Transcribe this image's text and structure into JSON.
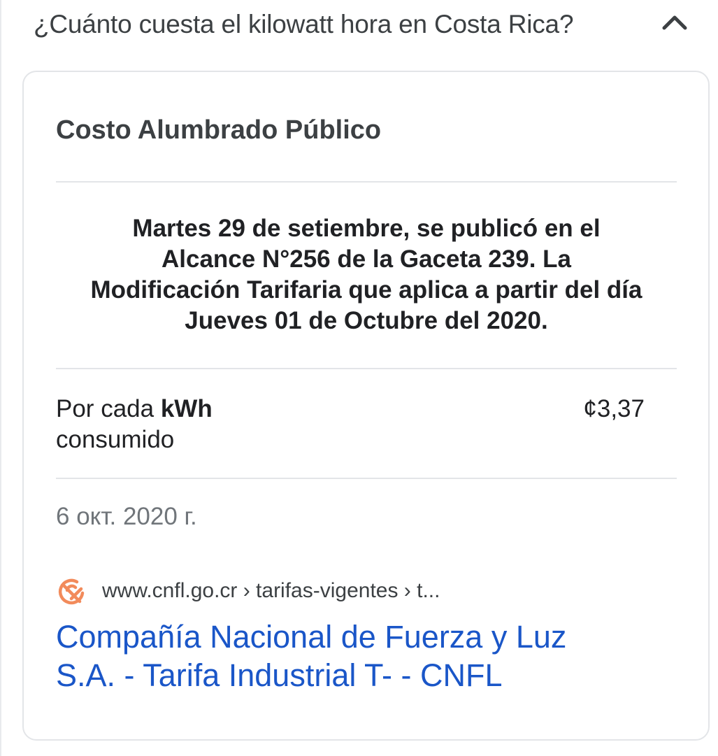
{
  "question": {
    "text": "¿Cuánto cuesta el kilowatt hora en Costa Rica?",
    "toggle_icon": "chevron-up-icon"
  },
  "card": {
    "title": "Costo Alumbrado Público",
    "announcement_lines": [
      "Martes 29 de setiembre, se publicó en el",
      "Alcance N°256 de la Gaceta 239. La",
      "Modificación Tarifaria que aplica a partir del día",
      "Jueves 01 de Octubre del 2020."
    ],
    "rate": {
      "label_prefix": "Por cada ",
      "label_bold": "kWh",
      "label_suffix": "consumido",
      "value": "¢3,37"
    },
    "date": "6 окт. 2020 г.",
    "source": {
      "favicon_icon": "cnfl-favicon-icon",
      "url": "www.cnfl.go.cr › tarifas-vigentes › t..."
    },
    "link_lines": [
      "Compañía Nacional de Fuerza y Luz",
      "S.A. - Tarifa Industrial T- - CNFL"
    ]
  },
  "colors": {
    "link": "#1a56c8",
    "favicon": "#f28b5b",
    "muted_text": "#70757a",
    "divider": "#e3e5e8"
  }
}
